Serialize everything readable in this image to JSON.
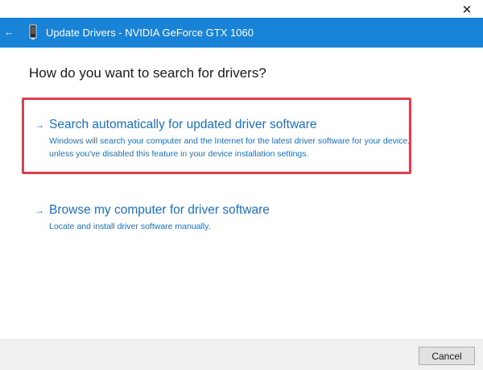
{
  "window": {
    "close_glyph": "✕",
    "title": "Update Drivers - NVIDIA GeForce GTX 1060",
    "back_glyph": "←"
  },
  "content": {
    "question": "How do you want to search for drivers?",
    "options": [
      {
        "arrow": "→",
        "title": "Search automatically for updated driver software",
        "description": "Windows will search your computer and the Internet for the latest driver software for your device, unless you've disabled this feature in your device installation settings.",
        "highlighted": true
      },
      {
        "arrow": "→",
        "title": "Browse my computer for driver software",
        "description": "Locate and install driver software manually.",
        "highlighted": false
      }
    ]
  },
  "footer": {
    "cancel_label": "Cancel"
  },
  "colors": {
    "header": "#1883d7",
    "link": "#1a6fc4",
    "highlight": "#e0404b",
    "footer": "#f0f0f0"
  },
  "icons": {
    "close": "close-icon",
    "back": "back-arrow-icon",
    "device": "device-icon",
    "option_arrow": "arrow-right-icon"
  }
}
